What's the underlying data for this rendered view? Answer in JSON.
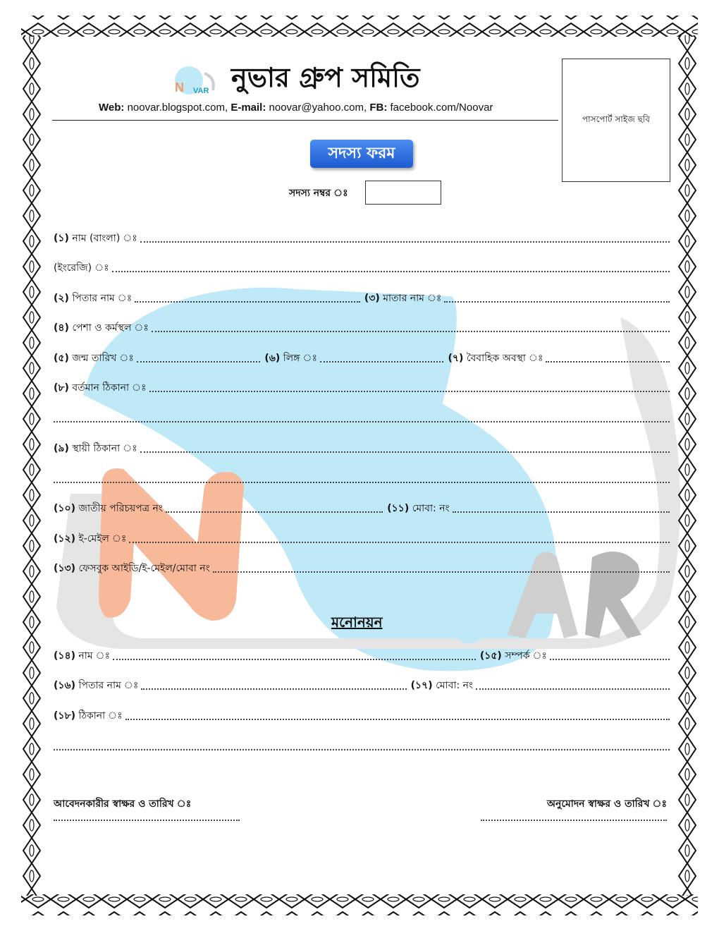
{
  "header": {
    "org_name": "নুভার গ্রুপ সমিতি",
    "web_label": "Web:",
    "web_value": "noovar.blogspot.com,",
    "email_label": "E-mail:",
    "email_value": "noovar@yahoo.com,",
    "fb_label": "FB:",
    "fb_value": "facebook.com/Noovar",
    "photo_label": "পাসপোর্ট সাইজ ছবি",
    "logo_text": "VAR",
    "logo_letter": "N"
  },
  "form": {
    "badge": "সদস্য ফরম",
    "member_no_label": "সদস্য নম্বর ঃ",
    "fields": {
      "f1_num": "(১)",
      "f1": "নাম (বাংলা) ঃ",
      "f1b": "(ইংরেজি) ঃ",
      "f2_num": "(২)",
      "f2": "পিতার নাম ঃ",
      "f3_num": "(৩)",
      "f3": "মাতার নাম ঃ",
      "f4_num": "(৪)",
      "f4": "পেশা ও কর্মস্থল ঃ",
      "f5_num": "(৫)",
      "f5": "জন্ম তারিখ ঃ",
      "f6_num": "(৬)",
      "f6": "লিঙ্গ ঃ",
      "f7_num": "(৭)",
      "f7": "বৈবাহিক অবস্থা ঃ",
      "f8_num": "(৮)",
      "f8": "বর্তমান ঠিকানা ঃ",
      "f9_num": "(৯)",
      "f9": "স্থায়ী ঠিকানা ঃ",
      "f10_num": "(১০)",
      "f10": "জাতীয় পরিচয়পত্র নং",
      "f11_num": "(১১)",
      "f11": "মোবা: নং",
      "f12_num": "(১২)",
      "f12": "ই-মেইল ঃ",
      "f13_num": "(১৩)",
      "f13": "ফেসবুক আইডি/ই-মেইল/মোবা নং"
    }
  },
  "nomination": {
    "title": "মনোনয়ন",
    "fields": {
      "f14_num": "(১৪)",
      "f14": "নাম ঃ",
      "f15_num": "(১৫)",
      "f15": "সম্পর্ক ঃ",
      "f16_num": "(১৬)",
      "f16": "পিতার নাম ঃ",
      "f17_num": "(১৭)",
      "f17": "মোবা: নং",
      "f18_num": "(১৮)",
      "f18": "ঠিকানা ঃ"
    }
  },
  "signatures": {
    "applicant": "আবেদনকারীর স্বাক্ষর ও তারিখ ঃ",
    "approval": "অনুমোদন স্বাক্ষর ও তারিখ ঃ"
  },
  "colors": {
    "watermark_blue": "#bfe9f7",
    "watermark_orange": "#f7b99a",
    "watermark_gray": "#d9d9d9",
    "badge_blue": "#2a6ee0",
    "border": "#111111"
  }
}
